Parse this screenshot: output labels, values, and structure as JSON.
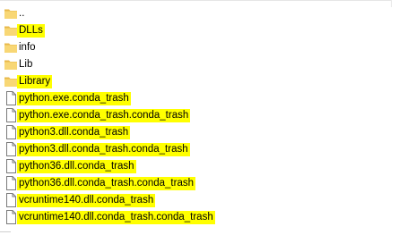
{
  "files": [
    {
      "name": "..",
      "kind": "folder",
      "highlighted": false,
      "icon": "folder-icon"
    },
    {
      "name": "DLLs",
      "kind": "folder",
      "highlighted": true,
      "icon": "folder-icon"
    },
    {
      "name": "info",
      "kind": "folder",
      "highlighted": false,
      "icon": "folder-icon"
    },
    {
      "name": "Lib",
      "kind": "folder",
      "highlighted": false,
      "icon": "folder-icon"
    },
    {
      "name": "Library",
      "kind": "folder",
      "highlighted": true,
      "icon": "folder-icon"
    },
    {
      "name": "python.exe.conda_trash",
      "kind": "file",
      "highlighted": true,
      "icon": "file-icon"
    },
    {
      "name": "python.exe.conda_trash.conda_trash",
      "kind": "file",
      "highlighted": true,
      "icon": "file-icon"
    },
    {
      "name": "python3.dll.conda_trash",
      "kind": "file",
      "highlighted": true,
      "icon": "file-icon"
    },
    {
      "name": "python3.dll.conda_trash.conda_trash",
      "kind": "file",
      "highlighted": true,
      "icon": "file-icon"
    },
    {
      "name": "python36.dll.conda_trash",
      "kind": "file",
      "highlighted": true,
      "icon": "file-icon"
    },
    {
      "name": "python36.dll.conda_trash.conda_trash",
      "kind": "file",
      "highlighted": true,
      "icon": "file-icon"
    },
    {
      "name": "vcruntime140.dll.conda_trash",
      "kind": "file",
      "highlighted": true,
      "icon": "file-icon"
    },
    {
      "name": "vcruntime140.dll.conda_trash.conda_trash",
      "kind": "file",
      "highlighted": true,
      "icon": "file-icon"
    }
  ],
  "colors": {
    "highlight": "#ffff00",
    "folder_body": "#f8d775",
    "folder_tab": "#e8b84a",
    "file_outline": "#7a7a7a"
  }
}
